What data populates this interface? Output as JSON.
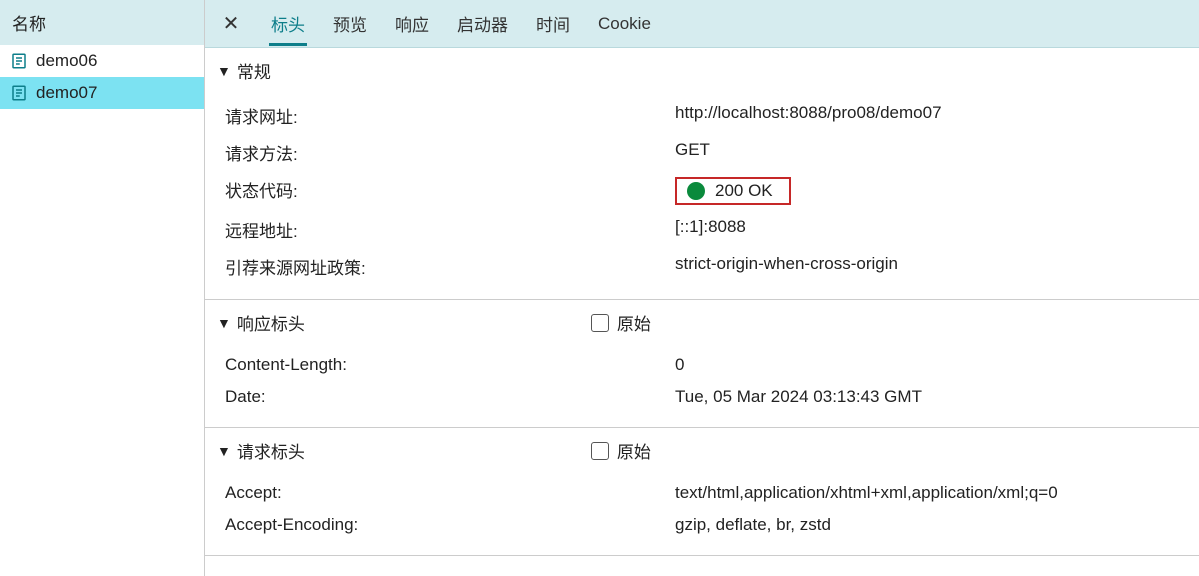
{
  "sidebar": {
    "header": "名称",
    "items": [
      {
        "label": "demo06",
        "selected": false
      },
      {
        "label": "demo07",
        "selected": true
      }
    ]
  },
  "tabs": {
    "close_icon": "✕",
    "items": [
      {
        "label": "标头",
        "active": true
      },
      {
        "label": "预览",
        "active": false
      },
      {
        "label": "响应",
        "active": false
      },
      {
        "label": "启动器",
        "active": false
      },
      {
        "label": "时间",
        "active": false
      },
      {
        "label": "Cookie",
        "active": false
      }
    ]
  },
  "general": {
    "title": "常规",
    "rows": [
      {
        "label": "请求网址:",
        "value": "http://localhost:8088/pro08/demo07",
        "status": false
      },
      {
        "label": "请求方法:",
        "value": "GET",
        "status": false
      },
      {
        "label": "状态代码:",
        "value": "200 OK",
        "status": true
      },
      {
        "label": "远程地址:",
        "value": "[::1]:8088",
        "status": false
      },
      {
        "label": "引荐来源网址政策:",
        "value": "strict-origin-when-cross-origin",
        "status": false
      }
    ]
  },
  "response_headers": {
    "title": "响应标头",
    "raw_label": "原始",
    "rows": [
      {
        "label": "Content-Length:",
        "value": "0"
      },
      {
        "label": "Date:",
        "value": "Tue, 05 Mar 2024 03:13:43 GMT"
      }
    ]
  },
  "request_headers": {
    "title": "请求标头",
    "raw_label": "原始",
    "rows": [
      {
        "label": "Accept:",
        "value": "text/html,application/xhtml+xml,application/xml;q=0"
      },
      {
        "label": "Accept-Encoding:",
        "value": "gzip, deflate, br, zstd"
      }
    ]
  }
}
